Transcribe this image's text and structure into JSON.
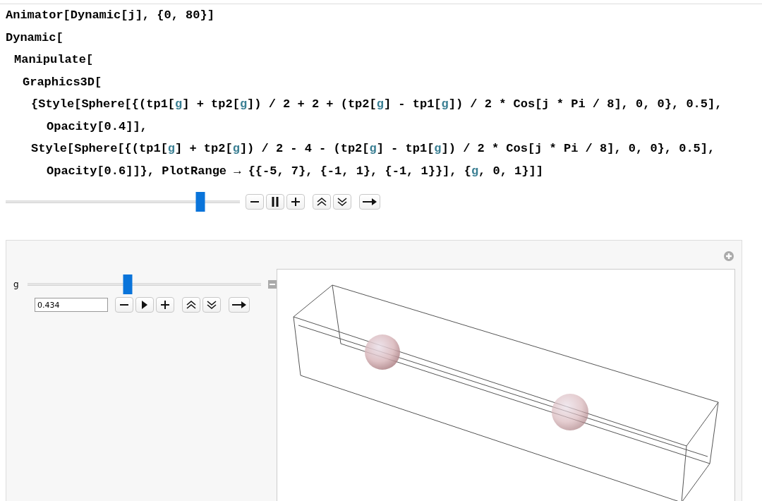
{
  "code": {
    "lines": [
      {
        "segments": [
          {
            "text": "Animator[Dynamic[j], {0, 80}]",
            "kind": "plain"
          }
        ]
      },
      {
        "segments": [
          {
            "text": "Dynamic[",
            "kind": "plain"
          }
        ],
        "children": [
          {
            "segments": [
              {
                "text": "Manipulate[",
                "kind": "plain"
              }
            ],
            "children": [
              {
                "segments": [
                  {
                    "text": "Graphics3D[",
                    "kind": "plain"
                  }
                ],
                "children": [
                  {
                    "segments": [
                      {
                        "text": "{Style[Sphere[{(tp1[",
                        "kind": "plain"
                      },
                      {
                        "text": "g",
                        "kind": "variable"
                      },
                      {
                        "text": "] + tp2[",
                        "kind": "plain"
                      },
                      {
                        "text": "g",
                        "kind": "variable"
                      },
                      {
                        "text": "]) / 2 + 2 + (tp2[",
                        "kind": "plain"
                      },
                      {
                        "text": "g",
                        "kind": "variable"
                      },
                      {
                        "text": "] - tp1[",
                        "kind": "plain"
                      },
                      {
                        "text": "g",
                        "kind": "variable"
                      },
                      {
                        "text": "]) / 2 * Cos[j * Pi / 8], 0, 0}, 0.5],",
                        "kind": "plain"
                      }
                    ],
                    "children": [
                      {
                        "segments": [
                          {
                            "text": "Opacity[0.4]],",
                            "kind": "plain"
                          }
                        ]
                      }
                    ]
                  },
                  {
                    "segments": [
                      {
                        "text": "Style[Sphere[{(tp1[",
                        "kind": "plain"
                      },
                      {
                        "text": "g",
                        "kind": "variable"
                      },
                      {
                        "text": "] + tp2[",
                        "kind": "plain"
                      },
                      {
                        "text": "g",
                        "kind": "variable"
                      },
                      {
                        "text": "]) / 2 - 4 - (tp2[",
                        "kind": "plain"
                      },
                      {
                        "text": "g",
                        "kind": "variable"
                      },
                      {
                        "text": "] - tp1[",
                        "kind": "plain"
                      },
                      {
                        "text": "g",
                        "kind": "variable"
                      },
                      {
                        "text": "]) / 2 * Cos[j * Pi / 8], 0, 0}, 0.5],",
                        "kind": "plain"
                      }
                    ],
                    "children": [
                      {
                        "segments": [
                          {
                            "text": "Opacity[0.6]]}, PlotRange → {{-5, 7}, {-1, 1}, {-1, 1}}], {",
                            "kind": "plain"
                          },
                          {
                            "text": "g",
                            "kind": "variable"
                          },
                          {
                            "text": ", 0, 1}]]",
                            "kind": "plain"
                          }
                        ]
                      }
                    ]
                  }
                ]
              }
            ]
          }
        ]
      }
    ]
  },
  "animator": {
    "level": 0.83,
    "playing": true
  },
  "manipulate": {
    "control_label": "g",
    "level": 0.43,
    "value": "0.434",
    "playing": false
  }
}
